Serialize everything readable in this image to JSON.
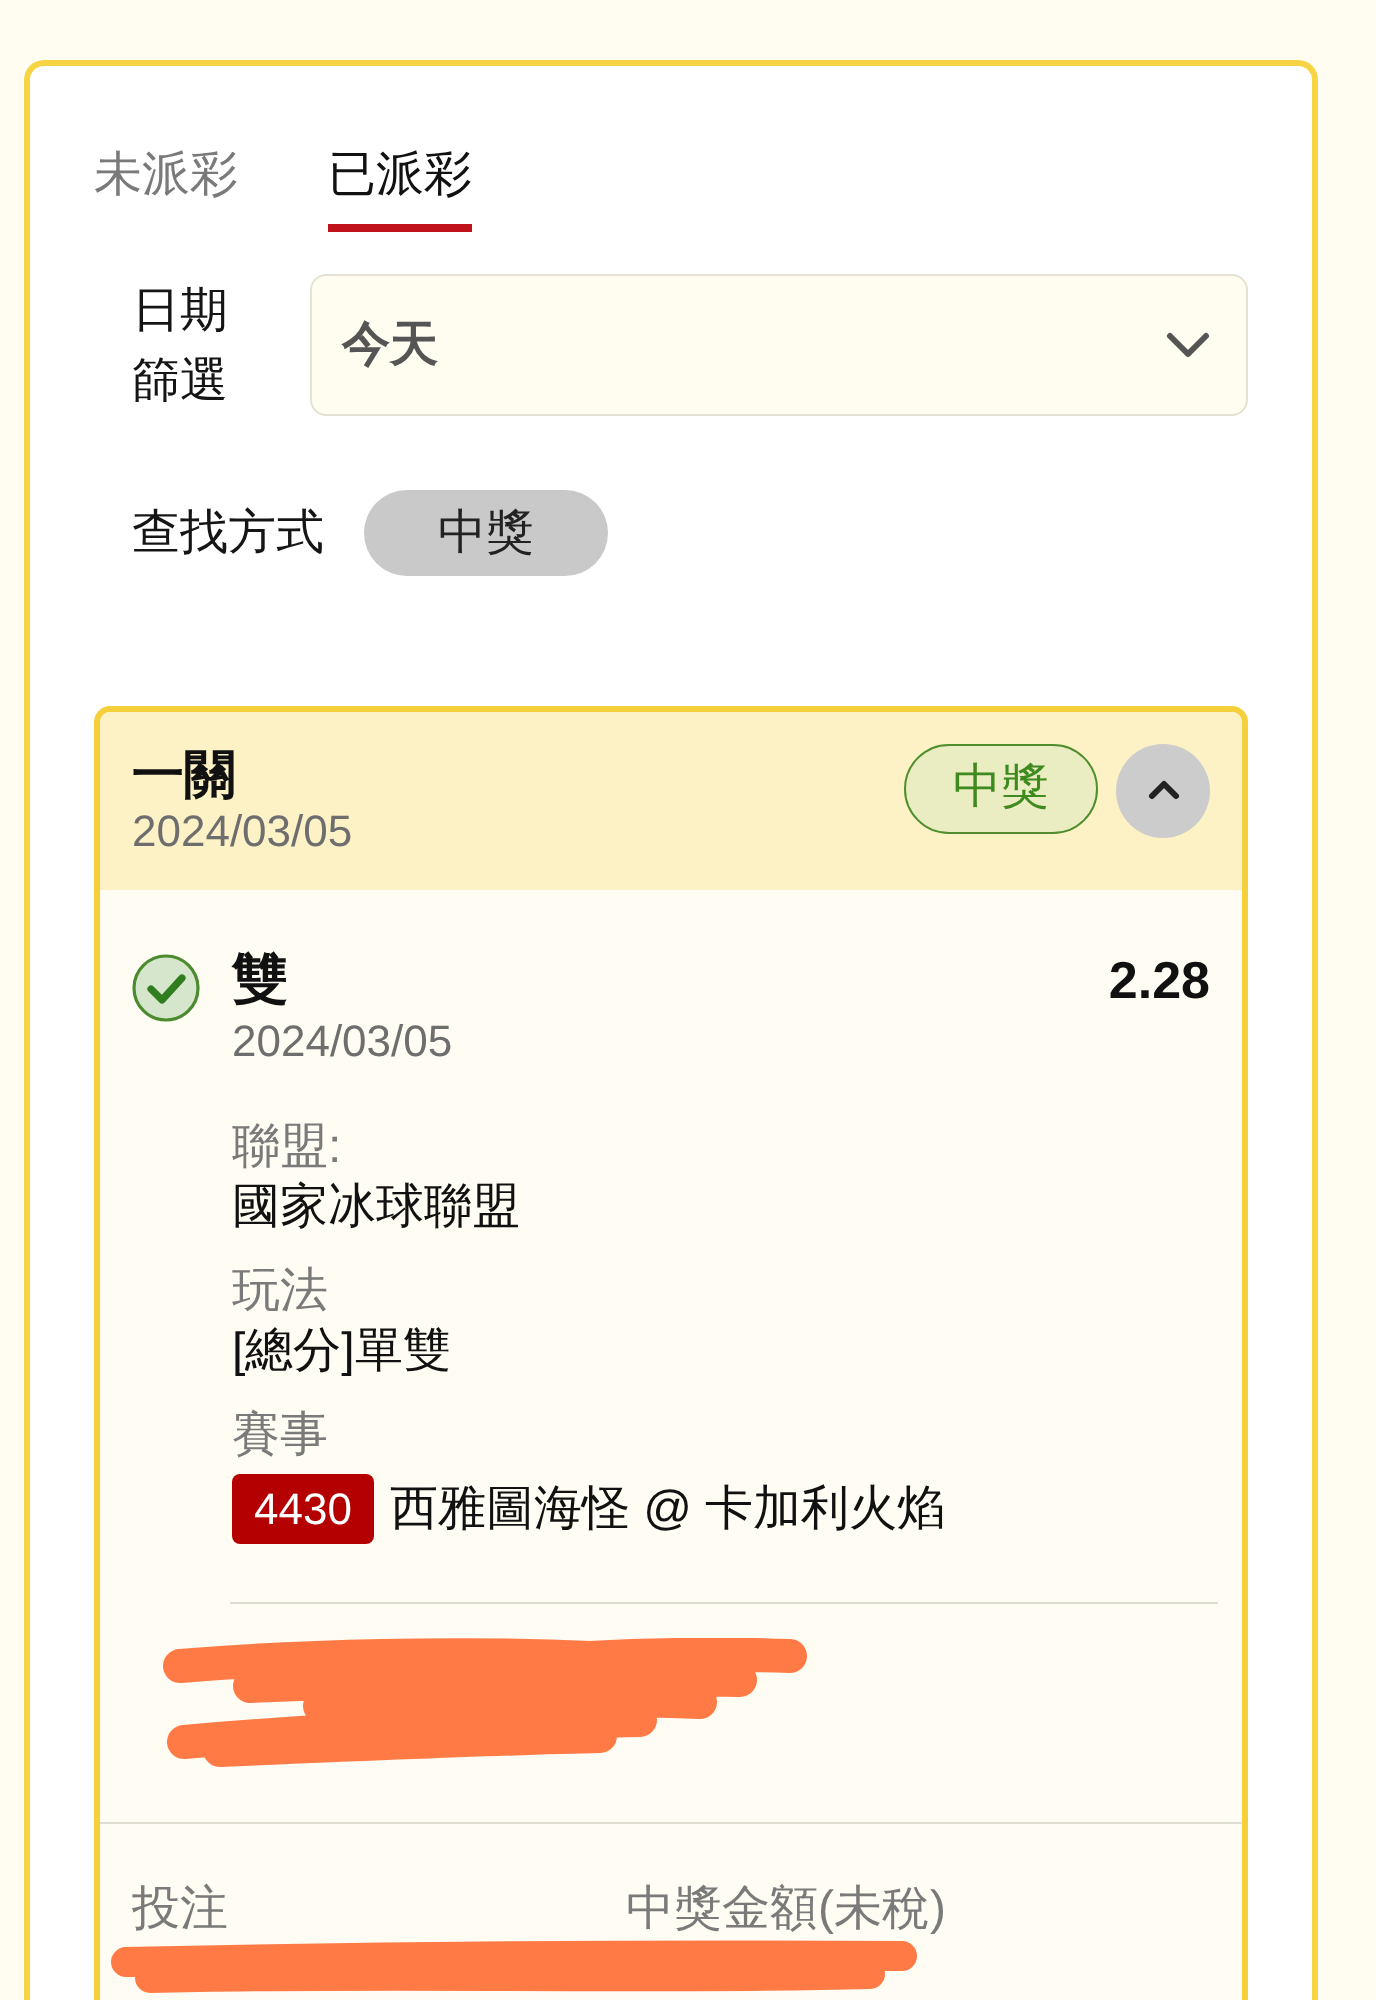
{
  "tabs": [
    {
      "label": "未派彩",
      "selected": false
    },
    {
      "label": "已派彩",
      "selected": true
    }
  ],
  "date_filter": {
    "label": "日期篩選",
    "value": "今天"
  },
  "search_mode": {
    "label": "查找方式",
    "chip": "中獎"
  },
  "bet": {
    "type": "一關",
    "date": "2024/03/05",
    "status": "中獎",
    "expanded": true,
    "selection": {
      "name": "雙",
      "date": "2024/03/05",
      "odds": "2.28",
      "won": true,
      "fields": [
        {
          "kind": "text",
          "label": "聯盟:",
          "value": "國家冰球聯盟"
        },
        {
          "kind": "text",
          "label": "玩法",
          "value": "[總分]單雙"
        },
        {
          "kind": "event",
          "label": "賽事",
          "code": "4430",
          "value": "西雅圖海怪 @ 卡加利火焰"
        }
      ]
    },
    "totals": [
      {
        "label": "投注"
      },
      {
        "label": "中獎金額(未稅)"
      }
    ]
  }
}
